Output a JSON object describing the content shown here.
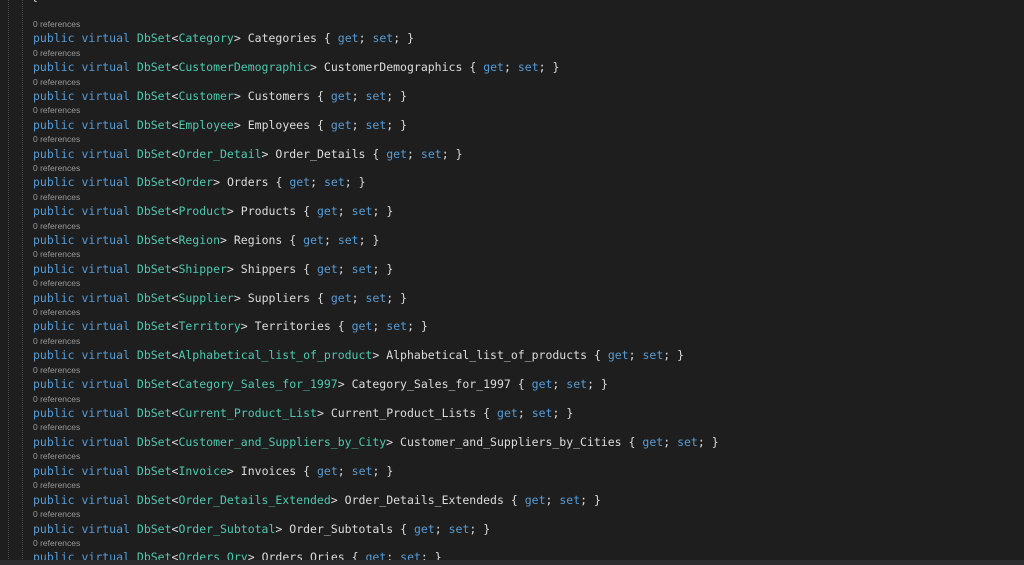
{
  "editor": {
    "top_brace": "{",
    "lines": [
      {
        "refs": "0 references",
        "public": "public",
        "virtual": "virtual",
        "dbset": "DbSet",
        "lt": "<",
        "entity": "Category",
        "gt": ">",
        "prop": "Categories",
        "open": "{",
        "get": "get",
        "semi1": ";",
        "set": "set",
        "semi2": ";",
        "close": "}"
      },
      {
        "refs": "0 references",
        "public": "public",
        "virtual": "virtual",
        "dbset": "DbSet",
        "lt": "<",
        "entity": "CustomerDemographic",
        "gt": ">",
        "prop": "CustomerDemographics",
        "open": "{",
        "get": "get",
        "semi1": ";",
        "set": "set",
        "semi2": ";",
        "close": "}"
      },
      {
        "refs": "0 references",
        "public": "public",
        "virtual": "virtual",
        "dbset": "DbSet",
        "lt": "<",
        "entity": "Customer",
        "gt": ">",
        "prop": "Customers",
        "open": "{",
        "get": "get",
        "semi1": ";",
        "set": "set",
        "semi2": ";",
        "close": "}"
      },
      {
        "refs": "0 references",
        "public": "public",
        "virtual": "virtual",
        "dbset": "DbSet",
        "lt": "<",
        "entity": "Employee",
        "gt": ">",
        "prop": "Employees",
        "open": "{",
        "get": "get",
        "semi1": ";",
        "set": "set",
        "semi2": ";",
        "close": "}"
      },
      {
        "refs": "0 references",
        "public": "public",
        "virtual": "virtual",
        "dbset": "DbSet",
        "lt": "<",
        "entity": "Order_Detail",
        "gt": ">",
        "prop": "Order_Details",
        "open": "{",
        "get": "get",
        "semi1": ";",
        "set": "set",
        "semi2": ";",
        "close": "}"
      },
      {
        "refs": "0 references",
        "public": "public",
        "virtual": "virtual",
        "dbset": "DbSet",
        "lt": "<",
        "entity": "Order",
        "gt": ">",
        "prop": "Orders",
        "open": "{",
        "get": "get",
        "semi1": ";",
        "set": "set",
        "semi2": ";",
        "close": "}"
      },
      {
        "refs": "0 references",
        "public": "public",
        "virtual": "virtual",
        "dbset": "DbSet",
        "lt": "<",
        "entity": "Product",
        "gt": ">",
        "prop": "Products",
        "open": "{",
        "get": "get",
        "semi1": ";",
        "set": "set",
        "semi2": ";",
        "close": "}"
      },
      {
        "refs": "0 references",
        "public": "public",
        "virtual": "virtual",
        "dbset": "DbSet",
        "lt": "<",
        "entity": "Region",
        "gt": ">",
        "prop": "Regions",
        "open": "{",
        "get": "get",
        "semi1": ";",
        "set": "set",
        "semi2": ";",
        "close": "}"
      },
      {
        "refs": "0 references",
        "public": "public",
        "virtual": "virtual",
        "dbset": "DbSet",
        "lt": "<",
        "entity": "Shipper",
        "gt": ">",
        "prop": "Shippers",
        "open": "{",
        "get": "get",
        "semi1": ";",
        "set": "set",
        "semi2": ";",
        "close": "}"
      },
      {
        "refs": "0 references",
        "public": "public",
        "virtual": "virtual",
        "dbset": "DbSet",
        "lt": "<",
        "entity": "Supplier",
        "gt": ">",
        "prop": "Suppliers",
        "open": "{",
        "get": "get",
        "semi1": ";",
        "set": "set",
        "semi2": ";",
        "close": "}"
      },
      {
        "refs": "0 references",
        "public": "public",
        "virtual": "virtual",
        "dbset": "DbSet",
        "lt": "<",
        "entity": "Territory",
        "gt": ">",
        "prop": "Territories",
        "open": "{",
        "get": "get",
        "semi1": ";",
        "set": "set",
        "semi2": ";",
        "close": "}"
      },
      {
        "refs": "0 references",
        "public": "public",
        "virtual": "virtual",
        "dbset": "DbSet",
        "lt": "<",
        "entity": "Alphabetical_list_of_product",
        "gt": ">",
        "prop": "Alphabetical_list_of_products",
        "open": "{",
        "get": "get",
        "semi1": ";",
        "set": "set",
        "semi2": ";",
        "close": "}"
      },
      {
        "refs": "0 references",
        "public": "public",
        "virtual": "virtual",
        "dbset": "DbSet",
        "lt": "<",
        "entity": "Category_Sales_for_1997",
        "gt": ">",
        "prop": "Category_Sales_for_1997",
        "open": "{",
        "get": "get",
        "semi1": ";",
        "set": "set",
        "semi2": ";",
        "close": "}"
      },
      {
        "refs": "0 references",
        "public": "public",
        "virtual": "virtual",
        "dbset": "DbSet",
        "lt": "<",
        "entity": "Current_Product_List",
        "gt": ">",
        "prop": "Current_Product_Lists",
        "open": "{",
        "get": "get",
        "semi1": ";",
        "set": "set",
        "semi2": ";",
        "close": "}"
      },
      {
        "refs": "0 references",
        "public": "public",
        "virtual": "virtual",
        "dbset": "DbSet",
        "lt": "<",
        "entity": "Customer_and_Suppliers_by_City",
        "gt": ">",
        "prop": "Customer_and_Suppliers_by_Cities",
        "open": "{",
        "get": "get",
        "semi1": ";",
        "set": "set",
        "semi2": ";",
        "close": "}"
      },
      {
        "refs": "0 references",
        "public": "public",
        "virtual": "virtual",
        "dbset": "DbSet",
        "lt": "<",
        "entity": "Invoice",
        "gt": ">",
        "prop": "Invoices",
        "open": "{",
        "get": "get",
        "semi1": ";",
        "set": "set",
        "semi2": ";",
        "close": "}"
      },
      {
        "refs": "0 references",
        "public": "public",
        "virtual": "virtual",
        "dbset": "DbSet",
        "lt": "<",
        "entity": "Order_Details_Extended",
        "gt": ">",
        "prop": "Order_Details_Extendeds",
        "open": "{",
        "get": "get",
        "semi1": ";",
        "set": "set",
        "semi2": ";",
        "close": "}"
      },
      {
        "refs": "0 references",
        "public": "public",
        "virtual": "virtual",
        "dbset": "DbSet",
        "lt": "<",
        "entity": "Order_Subtotal",
        "gt": ">",
        "prop": "Order_Subtotals",
        "open": "{",
        "get": "get",
        "semi1": ";",
        "set": "set",
        "semi2": ";",
        "close": "}"
      },
      {
        "refs": "0 references",
        "public": "public",
        "virtual": "virtual",
        "dbset": "DbSet",
        "lt": "<",
        "entity": "Orders_Qry",
        "gt": ">",
        "prop": "Orders_Qries",
        "open": "{",
        "get": "get",
        "semi1": ";",
        "set": "set",
        "semi2": ";",
        "close": "}"
      }
    ]
  }
}
